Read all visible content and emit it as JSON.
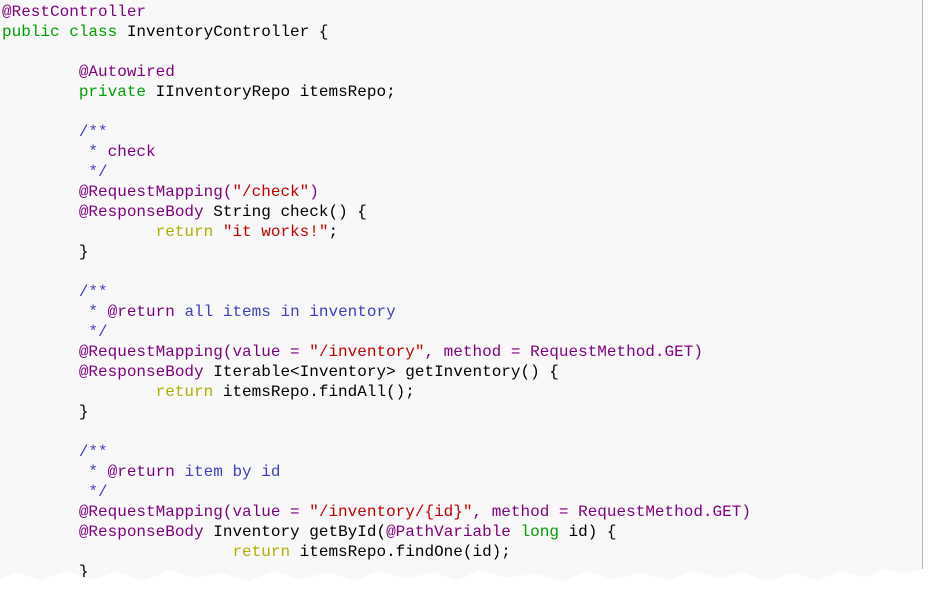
{
  "colors": {
    "annotation": "#7f007f",
    "keyword": "#00a000",
    "comment": "#3f3fbf",
    "string": "#c00000",
    "return": "#b0b000",
    "text": "#000000",
    "background": "#f8f8f8"
  },
  "code": {
    "lines": [
      [
        {
          "t": "@RestController",
          "c": "ann"
        }
      ],
      [
        {
          "t": "public class",
          "c": "kw"
        },
        {
          "t": " InventoryController {",
          "c": "txt"
        }
      ],
      [],
      [
        {
          "t": "        @Autowired",
          "c": "ann"
        }
      ],
      [
        {
          "t": "        private",
          "c": "kw"
        },
        {
          "t": " IInventoryRepo itemsRepo;",
          "c": "txt"
        }
      ],
      [],
      [
        {
          "t": "        /**",
          "c": "com"
        }
      ],
      [
        {
          "t": "         * ",
          "c": "com"
        },
        {
          "t": "check",
          "c": "tag"
        }
      ],
      [
        {
          "t": "         */",
          "c": "com"
        }
      ],
      [
        {
          "t": "        @RequestMapping(",
          "c": "ann"
        },
        {
          "t": "\"/check\"",
          "c": "str"
        },
        {
          "t": ")",
          "c": "ann"
        }
      ],
      [
        {
          "t": "        @ResponseBody",
          "c": "ann"
        },
        {
          "t": " String check() {",
          "c": "txt"
        }
      ],
      [
        {
          "t": "                return",
          "c": "ret"
        },
        {
          "t": " ",
          "c": "txt"
        },
        {
          "t": "\"it works!\"",
          "c": "str"
        },
        {
          "t": ";",
          "c": "txt"
        }
      ],
      [
        {
          "t": "        }",
          "c": "txt"
        }
      ],
      [],
      [
        {
          "t": "        /**",
          "c": "com"
        }
      ],
      [
        {
          "t": "         * ",
          "c": "com"
        },
        {
          "t": "@return",
          "c": "tag"
        },
        {
          "t": " all items in inventory",
          "c": "com"
        }
      ],
      [
        {
          "t": "         */",
          "c": "com"
        }
      ],
      [
        {
          "t": "        @RequestMapping(value = ",
          "c": "ann"
        },
        {
          "t": "\"/inventory\"",
          "c": "str"
        },
        {
          "t": ", method = RequestMethod.GET)",
          "c": "ann"
        }
      ],
      [
        {
          "t": "        @ResponseBody",
          "c": "ann"
        },
        {
          "t": " Iterable<Inventory> getInventory() {",
          "c": "txt"
        }
      ],
      [
        {
          "t": "                return",
          "c": "ret"
        },
        {
          "t": " itemsRepo.findAll();",
          "c": "txt"
        }
      ],
      [
        {
          "t": "        }",
          "c": "txt"
        }
      ],
      [],
      [
        {
          "t": "        /**",
          "c": "com"
        }
      ],
      [
        {
          "t": "         * ",
          "c": "com"
        },
        {
          "t": "@return",
          "c": "tag"
        },
        {
          "t": " item by id",
          "c": "com"
        }
      ],
      [
        {
          "t": "         */",
          "c": "com"
        }
      ],
      [
        {
          "t": "        @RequestMapping(value = ",
          "c": "ann"
        },
        {
          "t": "\"/inventory/{id}\"",
          "c": "str"
        },
        {
          "t": ", method = RequestMethod.GET)",
          "c": "ann"
        }
      ],
      [
        {
          "t": "        @ResponseBody",
          "c": "ann"
        },
        {
          "t": " Inventory getById(",
          "c": "txt"
        },
        {
          "t": "@PathVariable",
          "c": "ann"
        },
        {
          "t": " ",
          "c": "txt"
        },
        {
          "t": "long",
          "c": "kw"
        },
        {
          "t": " id) {",
          "c": "txt"
        }
      ],
      [
        {
          "t": "                        return",
          "c": "ret"
        },
        {
          "t": " itemsRepo.findOne(id);",
          "c": "txt"
        }
      ],
      [
        {
          "t": "        }",
          "c": "txt"
        }
      ]
    ]
  }
}
